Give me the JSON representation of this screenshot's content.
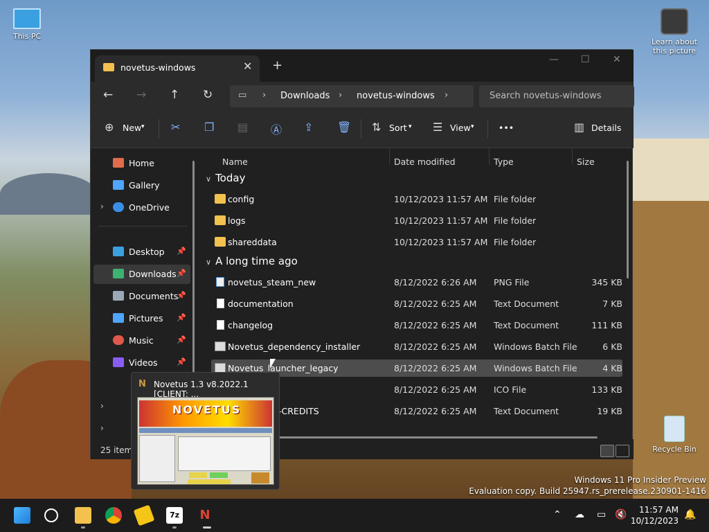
{
  "desktop": {
    "this_pc": "This PC",
    "learn": "Learn about this picture",
    "recycle": "Recycle Bin"
  },
  "window": {
    "tab_title": "novetus-windows",
    "close_tab": "✕",
    "new_tab": "+",
    "breadcrumb": [
      "Downloads",
      "novetus-windows"
    ],
    "search_placeholder": "Search novetus-windows",
    "toolbar": {
      "new": "New",
      "sort": "Sort",
      "view": "View",
      "more": "•••",
      "details": "Details"
    },
    "sidebar": [
      {
        "label": "Home",
        "color": "#e06c4c"
      },
      {
        "label": "Gallery",
        "color": "#4ea6ff"
      },
      {
        "label": "OneDrive",
        "color": "#3a8ee6"
      },
      {
        "label": "Desktop",
        "color": "#3aa0e0"
      },
      {
        "label": "Downloads",
        "color": "#3cb371"
      },
      {
        "label": "Documents",
        "color": "#9ba8b8"
      },
      {
        "label": "Pictures",
        "color": "#4ea6ff"
      },
      {
        "label": "Music",
        "color": "#e0584c"
      },
      {
        "label": "Videos",
        "color": "#8a5cf6"
      }
    ],
    "columns": {
      "name": "Name",
      "date": "Date modified",
      "type": "Type",
      "size": "Size"
    },
    "groups": {
      "today": "Today",
      "older": "A long time ago"
    },
    "files_today": [
      {
        "name": "config",
        "date": "10/12/2023 11:57 AM",
        "type": "File folder",
        "size": ""
      },
      {
        "name": "logs",
        "date": "10/12/2023 11:57 AM",
        "type": "File folder",
        "size": ""
      },
      {
        "name": "shareddata",
        "date": "10/12/2023 11:57 AM",
        "type": "File folder",
        "size": ""
      }
    ],
    "files_older": [
      {
        "name": "novetus_steam_new",
        "date": "8/12/2022 6:26 AM",
        "type": "PNG File",
        "size": "345 KB"
      },
      {
        "name": "documentation",
        "date": "8/12/2022 6:25 AM",
        "type": "Text Document",
        "size": "7 KB"
      },
      {
        "name": "changelog",
        "date": "8/12/2022 6:25 AM",
        "type": "Text Document",
        "size": "111 KB"
      },
      {
        "name": "Novetus_dependency_installer",
        "date": "8/12/2022 6:25 AM",
        "type": "Windows Batch File",
        "size": "6 KB"
      },
      {
        "name": "Novetus_launcher_legacy",
        "date": "8/12/2022 6:25 AM",
        "type": "Windows Batch File",
        "size": "4 KB"
      },
      {
        "name": "",
        "date": "8/12/2022 6:25 AM",
        "type": "ICO File",
        "size": "133 KB"
      },
      {
        "name": "-CREDITS",
        "date": "8/12/2022 6:25 AM",
        "type": "Text Document",
        "size": "19 KB"
      }
    ],
    "status": "25 items"
  },
  "thumbnail": {
    "title": "Novetus 1.3 v8.2022.1 [CLIENT: ...",
    "logo": "NOVETUS"
  },
  "watermark": {
    "line1": "Windows 11 Pro Insider Preview",
    "line2": "Evaluation copy. Build 25947.rs_prerelease.230901-1416"
  },
  "clock": {
    "time": "11:57 AM",
    "date": "10/12/2023"
  }
}
